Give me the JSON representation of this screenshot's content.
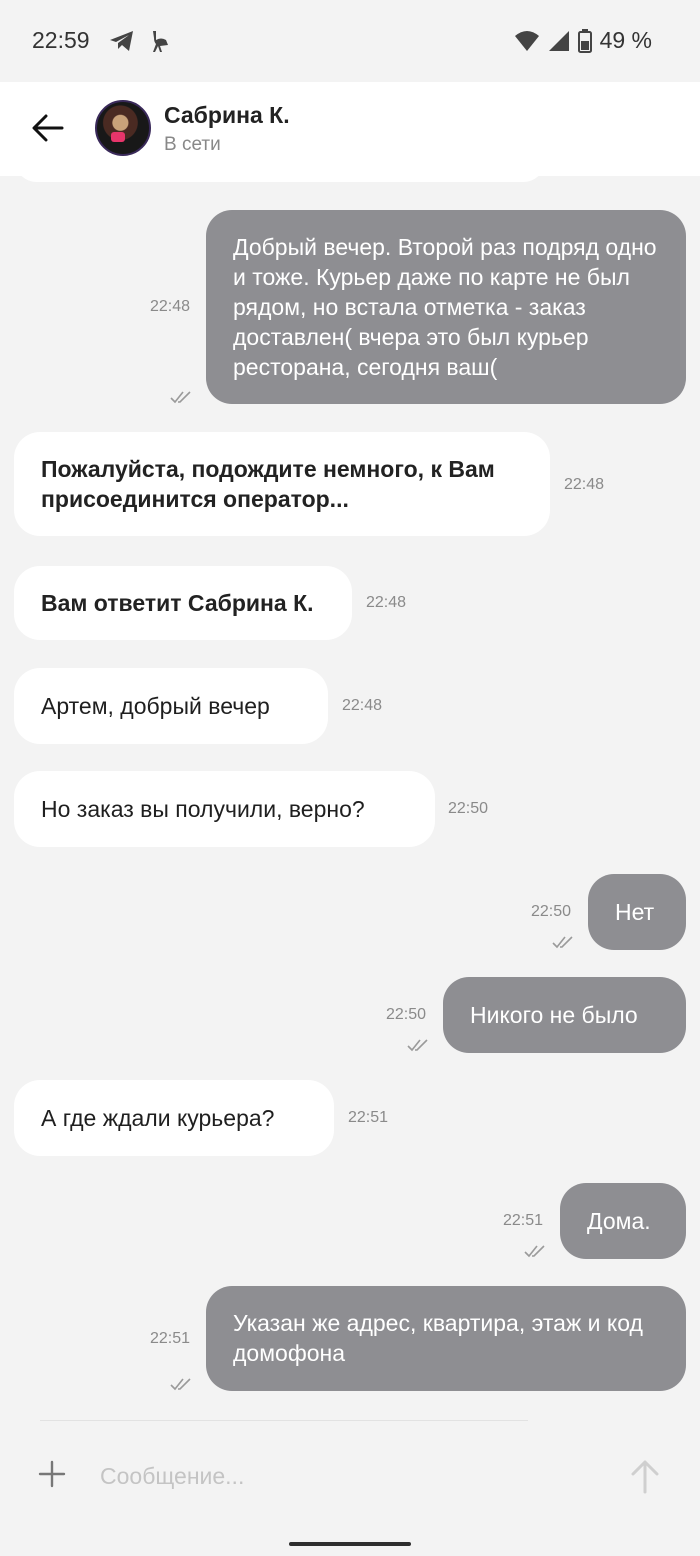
{
  "status_bar": {
    "time": "22:59",
    "battery": "49 %",
    "icons": [
      "telegram-icon",
      "ostrich-icon",
      "wifi-icon",
      "signal-icon",
      "battery-icon"
    ]
  },
  "header": {
    "back_icon": "arrow-left-icon",
    "contact_name": "Сабрина К.",
    "contact_status": "В сети"
  },
  "messages": [
    {
      "dir": "out",
      "text": "Добрый вечер. Второй раз подряд одно и тоже. Курьер даже по карте не был рядом, но встала отметка - заказ доставлен( вчера это был курьер ресторана, сегодня ваш(",
      "time": "22:48",
      "read": true
    },
    {
      "dir": "in",
      "text": "Пожалуйста, подождите немного, к Вам присоединится оператор...",
      "time": "22:48",
      "bold": true
    },
    {
      "dir": "in",
      "text": "Вам ответит Сабрина К.",
      "time": "22:48",
      "bold": true
    },
    {
      "dir": "in",
      "text": "Артем, добрый вечер",
      "time": "22:48"
    },
    {
      "dir": "in",
      "text": "Но заказ вы получили, верно?",
      "time": "22:50"
    },
    {
      "dir": "out",
      "text": "Нет",
      "time": "22:50",
      "read": true
    },
    {
      "dir": "out",
      "text": "Никого не было",
      "time": "22:50",
      "read": true
    },
    {
      "dir": "in",
      "text": "А где ждали курьера?",
      "time": "22:51"
    },
    {
      "dir": "out",
      "text": "Дома.",
      "time": "22:51",
      "read": true
    },
    {
      "dir": "out",
      "text": "Указан же адрес, квартира, этаж  и код домофона",
      "time": "22:51",
      "read": true
    }
  ],
  "composer": {
    "placeholder": "Сообщение...",
    "value": "",
    "attach_icon": "plus-icon",
    "send_icon": "arrow-up-icon"
  },
  "colors": {
    "background": "#f3f3f3",
    "incoming_bubble": "#ffffff",
    "outgoing_bubble": "#8e8e92",
    "timestamp": "#8a8a8a"
  }
}
